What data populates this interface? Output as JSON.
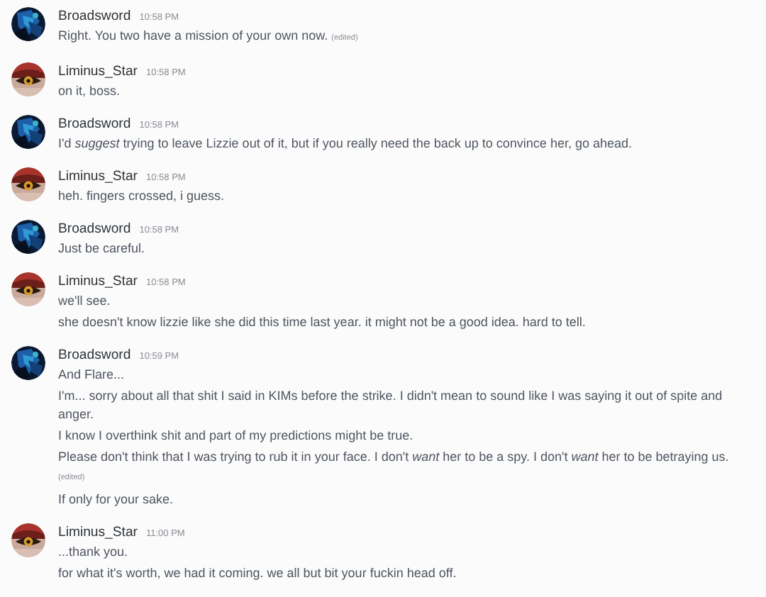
{
  "messages": [
    {
      "author": "Broadsword",
      "time": "10:58 PM",
      "lines": [
        {
          "text": "Right. You two have a mission of your own now.",
          "edited": "(edited)"
        }
      ]
    },
    {
      "author": "Liminus_Star",
      "time": "10:58 PM",
      "lines": [
        {
          "text": "on it, boss."
        }
      ]
    },
    {
      "author": "Broadsword",
      "time": "10:58 PM",
      "lines": [
        {
          "text": "I'd *suggest* trying to leave Lizzie out of it, but if you really need the back up to convince her, go ahead."
        }
      ]
    },
    {
      "author": "Liminus_Star",
      "time": "10:58 PM",
      "lines": [
        {
          "text": "heh. fingers crossed, i guess."
        }
      ]
    },
    {
      "author": "Broadsword",
      "time": "10:58 PM",
      "lines": [
        {
          "text": "Just be careful."
        }
      ]
    },
    {
      "author": "Liminus_Star",
      "time": "10:58 PM",
      "lines": [
        {
          "text": "we'll see."
        },
        {
          "text": "she doesn't know lizzie like she did this time last year. it might not be a good idea. hard to tell."
        }
      ]
    },
    {
      "author": "Broadsword",
      "time": "10:59 PM",
      "lines": [
        {
          "text": "And Flare..."
        },
        {
          "text": "I'm... sorry about all that shit I said in KIMs before the strike. I didn't mean to sound like I was saying it out of spite and anger."
        },
        {
          "text": "I know I overthink shit and part of my predictions might be true."
        },
        {
          "text": "Please don't think that I was trying to rub it in your face. I don't *want* her to be a spy. I don't *want* her to be betraying us.",
          "edited": "(edited)"
        },
        {
          "text": "If only for your sake."
        }
      ]
    },
    {
      "author": "Liminus_Star",
      "time": "11:00 PM",
      "lines": [
        {
          "text": "...thank you."
        },
        {
          "text": "for what it's worth, we had it coming. we all but bit your fuckin head off."
        }
      ]
    }
  ]
}
